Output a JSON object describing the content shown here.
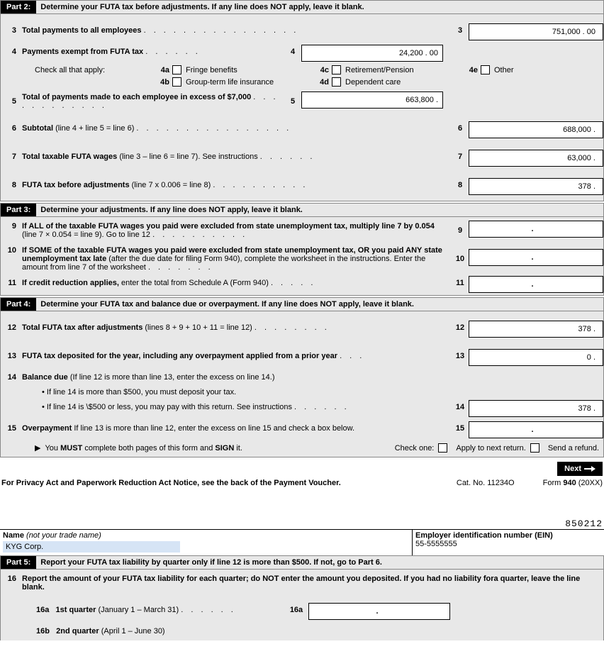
{
  "part2": {
    "label": "Part 2:",
    "title": "Determine your FUTA tax before adjustments. If any line does NOT apply, leave it blank.",
    "line3": {
      "num": "3",
      "label": "Total payments to all employees",
      "rnum": "3",
      "value": "751,000 . 00"
    },
    "line4": {
      "num": "4",
      "label_bold": "Payments exempt from FUTA tax",
      "mnum": "4",
      "value": "24,200 . 00"
    },
    "check_header": "Check all that apply:",
    "c4a": {
      "k": "4a",
      "label": "Fringe benefits"
    },
    "c4b": {
      "k": "4b",
      "label": "Group-term life insurance"
    },
    "c4c": {
      "k": "4c",
      "label": "Retirement/Pension"
    },
    "c4d": {
      "k": "4d",
      "label": "Dependent care"
    },
    "c4e": {
      "k": "4e",
      "label": "Other"
    },
    "line5": {
      "num": "5",
      "label_bold": "Total of payments made to each employee in excess of $7,000",
      "mnum": "5",
      "value": "663,800 ."
    },
    "line6": {
      "num": "6",
      "label_bold": "Subtotal",
      "label_norm": " (line 4 + line 5 = line 6)",
      "rnum": "6",
      "value": "688,000 ."
    },
    "line7": {
      "num": "7",
      "label_bold": "Total taxable FUTA wages",
      "label_norm": " (line 3 – line 6 = line 7). See instructions",
      "rnum": "7",
      "value": "63,000 ."
    },
    "line8": {
      "num": "8",
      "label_bold": "FUTA tax before adjustments",
      "label_norm": " (line 7 x 0.006 = line 8)",
      "rnum": "8",
      "value": "378 ."
    }
  },
  "part3": {
    "label": "Part 3:",
    "title": "Determine your adjustments. If any line does NOT apply, leave it blank.",
    "line9": {
      "num": "9",
      "label_bold": "If ALL of the taxable FUTA wages you paid were excluded from state unemployment tax, multiply line 7 by 0.054",
      "label_norm": " (line 7 × 0.054 = line 9). Go to line 12",
      "rnum": "9",
      "value": "."
    },
    "line10": {
      "num": "10",
      "label_bold": "If SOME of the taxable FUTA wages you paid were excluded from state unemployment tax, OR you paid ANY state unemployment tax late",
      "label_norm": " (after the due date for filing Form 940), complete the worksheet in the instructions. Enter the amount from line 7 of the worksheet",
      "rnum": "10",
      "value": "."
    },
    "line11": {
      "num": "11",
      "label_bold": "If credit reduction applies,",
      "label_norm": " enter the total from Schedule A (Form 940)",
      "rnum": "11",
      "value": "."
    }
  },
  "part4": {
    "label": "Part 4:",
    "title": "Determine your FUTA tax and balance due or overpayment. If any line does NOT apply, leave it blank.",
    "line12": {
      "num": "12",
      "label_bold": "Total FUTA tax after adjustments",
      "label_norm": " (lines 8 + 9 + 10 + 11 = line 12)",
      "rnum": "12",
      "value": "378 ."
    },
    "line13": {
      "num": "13",
      "label_bold": "FUTA tax deposited for the year, including any overpayment applied from a prior year",
      "rnum": "13",
      "value": "0 ."
    },
    "line14": {
      "num": "14",
      "label_bold": "Balance due",
      "label_norm": " (If line 12 is more than line 13, enter the excess on line 14.)",
      "rnum": "14",
      "value": "378 ."
    },
    "bullet1": "If line 14 is more than $500, you must deposit your tax.",
    "bullet2": "If line 14 is \\$500 or less, you may pay with this return. See instructions",
    "line15": {
      "num": "15",
      "label_bold": "Overpayment",
      "label_norm": " If line 13 is more than line 12, enter the excess on line 15 and check a box below.",
      "rnum": "15",
      "value": "."
    },
    "must_line": "You MUST complete both pages of this form and SIGN it.",
    "check_one": "Check one:",
    "opt1": "Apply to next return.",
    "opt2": "Send a refund."
  },
  "next_btn": "Next",
  "footer": {
    "left": "For Privacy Act and Paperwork Reduction Act Notice, see the back of the Payment Voucher.",
    "mid": "Cat. No. 11234O",
    "right_pre": "Form ",
    "right_bold": "940",
    "right_post": " (20XX)"
  },
  "page2_code": "850212",
  "name_row": {
    "name_hdr": "Name",
    "name_it": " (not your trade name)",
    "name_val": "KYG Corp.",
    "ein_hdr": "Employer identification number (EIN)",
    "ein_val": "55-5555555"
  },
  "part5": {
    "label": "Part 5:",
    "title": "Report your FUTA tax liability by quarter only if line 12 is more than $500. If not, go to Part 6.",
    "line16": {
      "num": "16",
      "label": "Report the amount of your FUTA tax liability for each quarter; do NOT enter the amount you deposited. If you had no liability fora quarter, leave the line blank."
    },
    "line16a": {
      "k": "16a",
      "label_bold": "1st quarter",
      "label_norm": " (January 1 – March 31)",
      "mnum": "16a",
      "value": "."
    },
    "line16b": {
      "k": "16b",
      "label_bold": "2nd quarter",
      "label_norm": " (April 1 – June 30)"
    }
  }
}
